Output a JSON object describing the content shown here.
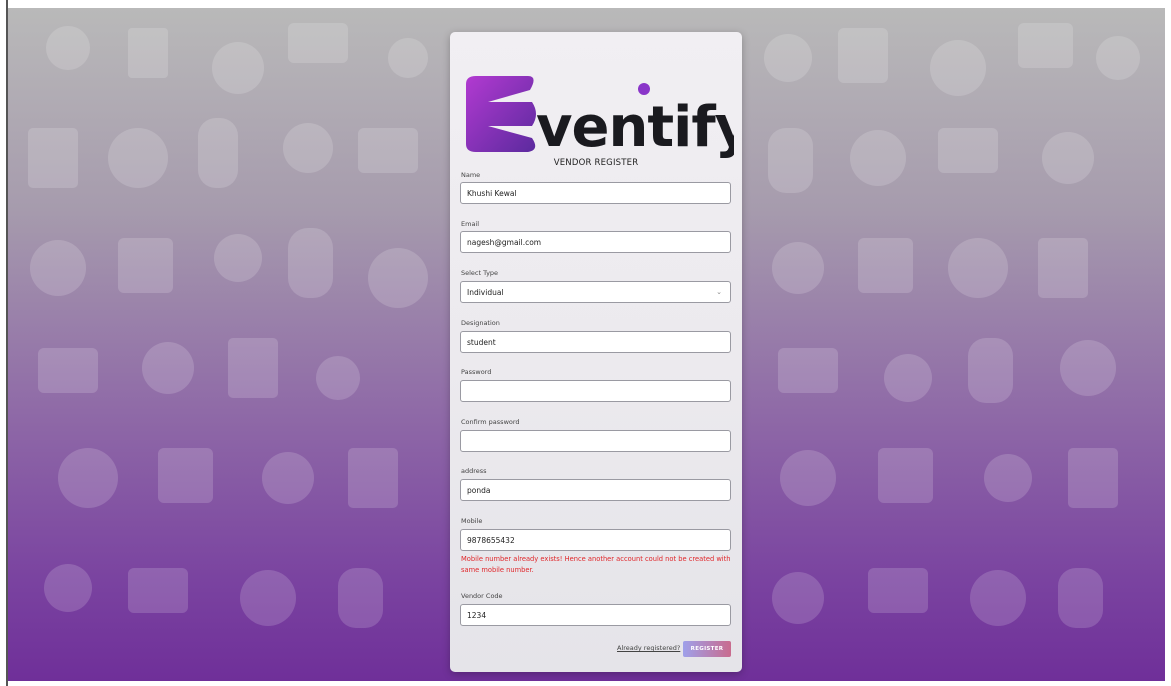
{
  "brand": {
    "name": "Eventify"
  },
  "form": {
    "title": "VENDOR REGISTER",
    "fields": {
      "name": {
        "label": "Name",
        "value": "Khushi Kewal"
      },
      "email": {
        "label": "Email",
        "value": "nagesh@gmail.com"
      },
      "type": {
        "label": "Select Type",
        "value": "Individual"
      },
      "designation": {
        "label": "Designation",
        "value": "student"
      },
      "password": {
        "label": "Password",
        "value": ""
      },
      "confirm": {
        "label": "Confirm password",
        "value": ""
      },
      "address": {
        "label": "address",
        "value": "ponda"
      },
      "mobile": {
        "label": "Mobile",
        "value": "9878655432"
      },
      "vendor_code": {
        "label": "Vendor Code",
        "value": "1234"
      }
    },
    "error": "Mobile number already exists! Hence another account could not be created with same mobile number.",
    "already_link": "Already registered?",
    "submit": "REGISTER"
  },
  "colors": {
    "accent_start": "#9fa0ea",
    "accent_end": "#c96b8e",
    "error": "#e0262a",
    "logo_purple": "#7a2fc0"
  },
  "icons": {
    "select": "chevron-down-icon"
  }
}
